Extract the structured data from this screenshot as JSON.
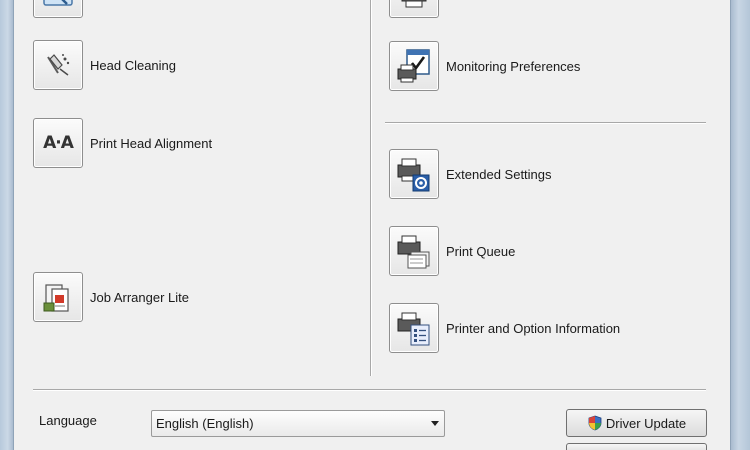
{
  "left_tools": [
    {
      "label": "",
      "icon": "nozzle-check-icon"
    },
    {
      "label": "Head Cleaning",
      "icon": "head-cleaning-icon"
    },
    {
      "label": "Print Head Alignment",
      "icon": "print-head-alignment-icon"
    },
    {
      "label": "Job Arranger Lite",
      "icon": "job-arranger-icon"
    }
  ],
  "right_tools": [
    {
      "label": "",
      "icon": "status-monitor-icon"
    },
    {
      "label": "Monitoring Preferences",
      "icon": "monitoring-preferences-icon"
    },
    {
      "label": "Extended Settings",
      "icon": "extended-settings-icon"
    },
    {
      "label": "Print Queue",
      "icon": "print-queue-icon"
    },
    {
      "label": "Printer and Option Information",
      "icon": "printer-info-icon"
    }
  ],
  "alignment_glyph": "A·A",
  "language": {
    "label": "Language",
    "selected": "English (English)"
  },
  "driver_update": {
    "label": "Driver Update",
    "icon": "uac-shield-icon"
  },
  "colors": {
    "panel": "#f0f0f0",
    "divider": "#a8a8a8",
    "window_frame": "#c8d6e4"
  }
}
